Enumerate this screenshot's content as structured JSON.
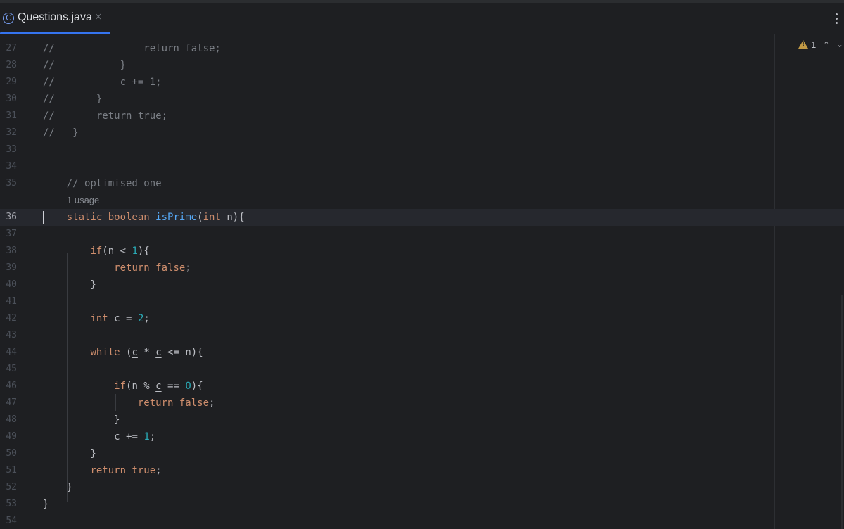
{
  "tab": {
    "icon_letter": "C",
    "filename": "Questions.java",
    "close_glyph": "×"
  },
  "inspections": {
    "warning_count": "1",
    "prev_glyph": "⌃",
    "next_glyph": "⌄"
  },
  "editor": {
    "usage_hint": "1 usage",
    "lines": [
      {
        "n": "27",
        "text": "//               return false;"
      },
      {
        "n": "28",
        "text": "//           }"
      },
      {
        "n": "29",
        "text": "//           c += 1;"
      },
      {
        "n": "30",
        "text": "//       }"
      },
      {
        "n": "31",
        "text": "//       return true;"
      },
      {
        "n": "32",
        "text": "//   }"
      },
      {
        "n": "33",
        "text": ""
      },
      {
        "n": "34",
        "text": ""
      },
      {
        "n": "35",
        "text": "    // optimised one"
      },
      {
        "n": "36",
        "text": "    static boolean isPrime(int n){"
      },
      {
        "n": "37",
        "text": ""
      },
      {
        "n": "38",
        "text": "        if(n < 1){"
      },
      {
        "n": "39",
        "text": "            return false;"
      },
      {
        "n": "40",
        "text": "        }"
      },
      {
        "n": "41",
        "text": ""
      },
      {
        "n": "42",
        "text": "        int c = 2;"
      },
      {
        "n": "43",
        "text": ""
      },
      {
        "n": "44",
        "text": "        while (c * c <= n){"
      },
      {
        "n": "45",
        "text": ""
      },
      {
        "n": "46",
        "text": "            if(n % c == 0){"
      },
      {
        "n": "47",
        "text": "                return false;"
      },
      {
        "n": "48",
        "text": "            }"
      },
      {
        "n": "49",
        "text": "            c += 1;"
      },
      {
        "n": "50",
        "text": "        }"
      },
      {
        "n": "51",
        "text": "        return true;"
      },
      {
        "n": "52",
        "text": "    }"
      },
      {
        "n": "53",
        "text": "}"
      },
      {
        "n": "54",
        "text": ""
      }
    ]
  },
  "colors": {
    "background": "#1e1f22",
    "keyword": "#cf8e6d",
    "function": "#56a8f5",
    "number": "#2aacb8",
    "comment": "#7a7e85",
    "text": "#bcbec4",
    "tab_accent": "#3574f0",
    "warning": "#c29a45"
  },
  "icons": [
    "java-class-icon",
    "close-icon",
    "more-options-icon",
    "warning-icon",
    "chevron-up-icon",
    "chevron-down-icon"
  ]
}
